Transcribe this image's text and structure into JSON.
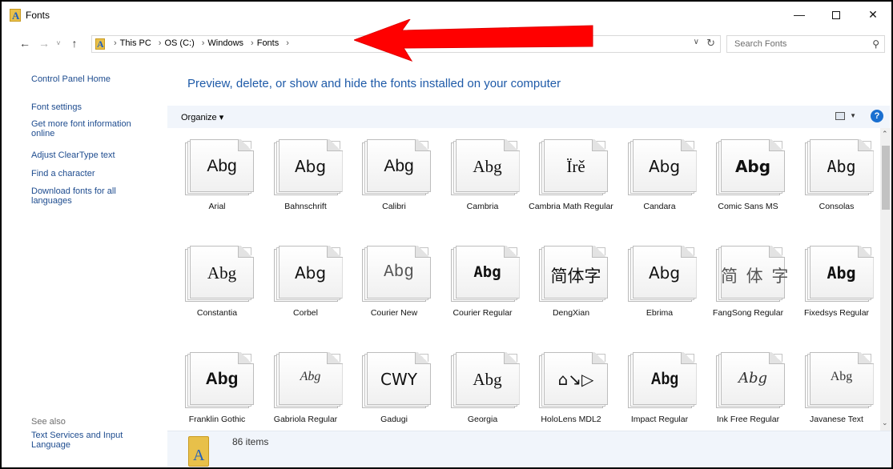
{
  "window": {
    "title": "Fonts"
  },
  "nav": {
    "back": "←",
    "forward": "→",
    "recent": "˅",
    "up": "↑",
    "breadcrumbs": [
      "This PC",
      "OS (C:)",
      "Windows",
      "Fonts"
    ],
    "separator": "›",
    "search_placeholder": "Search Fonts"
  },
  "left_pane": {
    "links": [
      "Control Panel Home",
      "Font settings",
      "Get more font information online",
      "Adjust ClearType text",
      "Find a character",
      "Download fonts for all languages"
    ],
    "see_also_label": "See also",
    "see_also_links": [
      "Text Services and Input Language"
    ]
  },
  "headline": "Preview, delete, or show and hide the fonts installed on your computer",
  "toolbar": {
    "organize_label": "Organize ▾",
    "help": "?"
  },
  "fonts": [
    {
      "name": "Arial",
      "sample": "Abg"
    },
    {
      "name": "Bahnschrift",
      "sample": "Abg"
    },
    {
      "name": "Calibri",
      "sample": "Abg"
    },
    {
      "name": "Cambria",
      "sample": "Abg"
    },
    {
      "name": "Cambria Math Regular",
      "sample": "Ïrě"
    },
    {
      "name": "Candara",
      "sample": "Abg"
    },
    {
      "name": "Comic Sans MS",
      "sample": "Abg"
    },
    {
      "name": "Consolas",
      "sample": "Abg"
    },
    {
      "name": "Constantia",
      "sample": "Abg"
    },
    {
      "name": "Corbel",
      "sample": "Abg"
    },
    {
      "name": "Courier New",
      "sample": "Abg"
    },
    {
      "name": "Courier Regular",
      "sample": "Abg"
    },
    {
      "name": "DengXian",
      "sample": "简体字"
    },
    {
      "name": "Ebrima",
      "sample": "Abg"
    },
    {
      "name": "FangSong Regular",
      "sample": "简 体 字"
    },
    {
      "name": "Fixedsys Regular",
      "sample": "Abg"
    },
    {
      "name": "Franklin Gothic",
      "sample": "Abg"
    },
    {
      "name": "Gabriola Regular",
      "sample": "Abg"
    },
    {
      "name": "Gadugi",
      "sample": "CWY"
    },
    {
      "name": "Georgia",
      "sample": "Abg"
    },
    {
      "name": "HoloLens MDL2",
      "sample": "⌂↘▷"
    },
    {
      "name": "Impact Regular",
      "sample": "Abg"
    },
    {
      "name": "Ink Free Regular",
      "sample": "Abg"
    },
    {
      "name": "Javanese Text",
      "sample": "Abg"
    }
  ],
  "status": {
    "item_count": "86 items"
  },
  "colors": {
    "link": "#1e4c8f",
    "headline": "#1e5aa8",
    "toolbar_bg": "#f1f5fb",
    "arrow": "#ff0000"
  }
}
